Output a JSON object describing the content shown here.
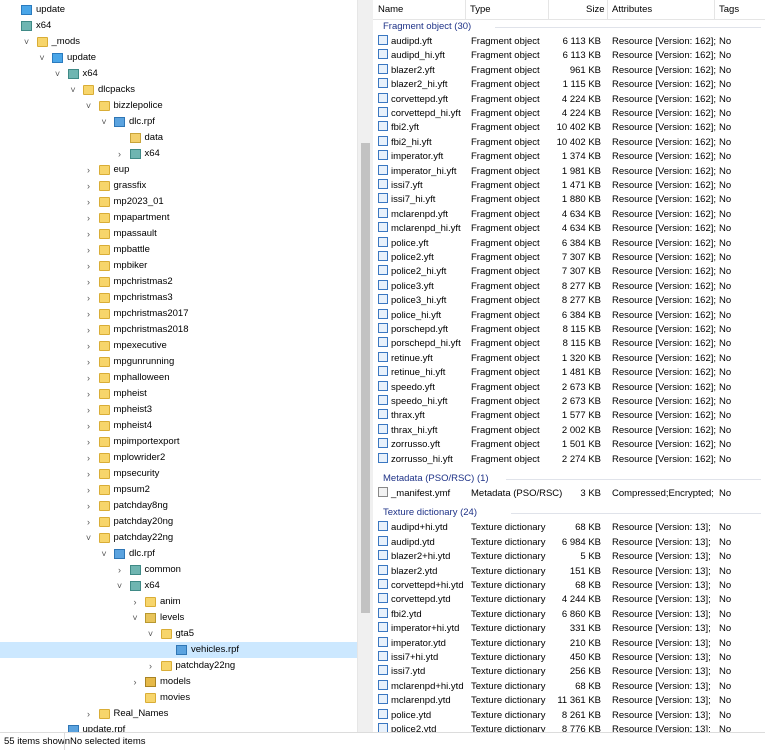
{
  "tree": [
    {
      "label": "update",
      "indent": 0,
      "chev": "",
      "icon": "folder-blue"
    },
    {
      "label": "x64",
      "indent": 0,
      "chev": "",
      "icon": "folder-teal"
    },
    {
      "label": "_mods",
      "indent": 1,
      "chev": "v",
      "icon": "folder"
    },
    {
      "label": "update",
      "indent": 2,
      "chev": "v",
      "icon": "folder-blue"
    },
    {
      "label": "x64",
      "indent": 3,
      "chev": "v",
      "icon": "folder-teal"
    },
    {
      "label": "dlcpacks",
      "indent": 4,
      "chev": "v",
      "icon": "folder"
    },
    {
      "label": "bizzlepolice",
      "indent": 5,
      "chev": "v",
      "icon": "folder"
    },
    {
      "label": "dlc.rpf",
      "indent": 6,
      "chev": "v",
      "icon": "rpf"
    },
    {
      "label": "data",
      "indent": 7,
      "chev": "",
      "icon": "data"
    },
    {
      "label": "x64",
      "indent": 7,
      "chev": ">",
      "icon": "folder-teal"
    },
    {
      "label": "eup",
      "indent": 5,
      "chev": ">",
      "icon": "folder"
    },
    {
      "label": "grassfix",
      "indent": 5,
      "chev": ">",
      "icon": "folder"
    },
    {
      "label": "mp2023_01",
      "indent": 5,
      "chev": ">",
      "icon": "folder"
    },
    {
      "label": "mpapartment",
      "indent": 5,
      "chev": ">",
      "icon": "folder"
    },
    {
      "label": "mpassault",
      "indent": 5,
      "chev": ">",
      "icon": "folder"
    },
    {
      "label": "mpbattle",
      "indent": 5,
      "chev": ">",
      "icon": "folder"
    },
    {
      "label": "mpbiker",
      "indent": 5,
      "chev": ">",
      "icon": "folder"
    },
    {
      "label": "mpchristmas2",
      "indent": 5,
      "chev": ">",
      "icon": "folder"
    },
    {
      "label": "mpchristmas3",
      "indent": 5,
      "chev": ">",
      "icon": "folder"
    },
    {
      "label": "mpchristmas2017",
      "indent": 5,
      "chev": ">",
      "icon": "folder"
    },
    {
      "label": "mpchristmas2018",
      "indent": 5,
      "chev": ">",
      "icon": "folder"
    },
    {
      "label": "mpexecutive",
      "indent": 5,
      "chev": ">",
      "icon": "folder"
    },
    {
      "label": "mpgunrunning",
      "indent": 5,
      "chev": ">",
      "icon": "folder"
    },
    {
      "label": "mphalloween",
      "indent": 5,
      "chev": ">",
      "icon": "folder"
    },
    {
      "label": "mpheist",
      "indent": 5,
      "chev": ">",
      "icon": "folder"
    },
    {
      "label": "mpheist3",
      "indent": 5,
      "chev": ">",
      "icon": "folder"
    },
    {
      "label": "mpheist4",
      "indent": 5,
      "chev": ">",
      "icon": "folder"
    },
    {
      "label": "mpimportexport",
      "indent": 5,
      "chev": ">",
      "icon": "folder"
    },
    {
      "label": "mplowrider2",
      "indent": 5,
      "chev": ">",
      "icon": "folder"
    },
    {
      "label": "mpsecurity",
      "indent": 5,
      "chev": ">",
      "icon": "folder"
    },
    {
      "label": "mpsum2",
      "indent": 5,
      "chev": ">",
      "icon": "folder"
    },
    {
      "label": "patchday8ng",
      "indent": 5,
      "chev": ">",
      "icon": "folder"
    },
    {
      "label": "patchday20ng",
      "indent": 5,
      "chev": ">",
      "icon": "folder"
    },
    {
      "label": "patchday22ng",
      "indent": 5,
      "chev": "v",
      "icon": "folder"
    },
    {
      "label": "dlc.rpf",
      "indent": 6,
      "chev": "v",
      "icon": "rpf"
    },
    {
      "label": "common",
      "indent": 7,
      "chev": ">",
      "icon": "folder-teal"
    },
    {
      "label": "x64",
      "indent": 7,
      "chev": "v",
      "icon": "folder-teal"
    },
    {
      "label": "anim",
      "indent": 8,
      "chev": ">",
      "icon": "folder"
    },
    {
      "label": "levels",
      "indent": 8,
      "chev": "v",
      "icon": "levels"
    },
    {
      "label": "gta5",
      "indent": 9,
      "chev": "v",
      "icon": "folder"
    },
    {
      "label": "vehicles.rpf",
      "indent": 10,
      "chev": "",
      "icon": "rpf",
      "selected": true
    },
    {
      "label": "patchday22ng",
      "indent": 9,
      "chev": ">",
      "icon": "folder"
    },
    {
      "label": "models",
      "indent": 8,
      "chev": ">",
      "icon": "models"
    },
    {
      "label": "movies",
      "indent": 8,
      "chev": "",
      "icon": "folder"
    },
    {
      "label": "Real_Names",
      "indent": 5,
      "chev": ">",
      "icon": "folder"
    },
    {
      "label": "update.rpf",
      "indent": 3,
      "chev": "",
      "icon": "rpf"
    }
  ],
  "columns": {
    "name": "Name",
    "type": "Type",
    "size": "Size",
    "attributes": "Attributes",
    "tags": "Tags"
  },
  "groups": [
    {
      "title": "Fragment object (30)",
      "icon": "file",
      "rows": [
        [
          "audipd.yft",
          "Fragment object",
          "6 113 KB",
          "Resource [Version: 162];",
          "No"
        ],
        [
          "audipd_hi.yft",
          "Fragment object",
          "6 113 KB",
          "Resource [Version: 162];",
          "No"
        ],
        [
          "blazer2.yft",
          "Fragment object",
          "961 KB",
          "Resource [Version: 162];",
          "No"
        ],
        [
          "blazer2_hi.yft",
          "Fragment object",
          "1 115 KB",
          "Resource [Version: 162];",
          "No"
        ],
        [
          "corvettepd.yft",
          "Fragment object",
          "4 224 KB",
          "Resource [Version: 162];",
          "No"
        ],
        [
          "corvettepd_hi.yft",
          "Fragment object",
          "4 224 KB",
          "Resource [Version: 162];",
          "No"
        ],
        [
          "fbi2.yft",
          "Fragment object",
          "10 402 KB",
          "Resource [Version: 162];",
          "No"
        ],
        [
          "fbi2_hi.yft",
          "Fragment object",
          "10 402 KB",
          "Resource [Version: 162];",
          "No"
        ],
        [
          "imperator.yft",
          "Fragment object",
          "1 374 KB",
          "Resource [Version: 162];",
          "No"
        ],
        [
          "imperator_hi.yft",
          "Fragment object",
          "1 981 KB",
          "Resource [Version: 162];",
          "No"
        ],
        [
          "issi7.yft",
          "Fragment object",
          "1 471 KB",
          "Resource [Version: 162];",
          "No"
        ],
        [
          "issi7_hi.yft",
          "Fragment object",
          "1 880 KB",
          "Resource [Version: 162];",
          "No"
        ],
        [
          "mclarenpd.yft",
          "Fragment object",
          "4 634 KB",
          "Resource [Version: 162];",
          "No"
        ],
        [
          "mclarenpd_hi.yft",
          "Fragment object",
          "4 634 KB",
          "Resource [Version: 162];",
          "No"
        ],
        [
          "police.yft",
          "Fragment object",
          "6 384 KB",
          "Resource [Version: 162];",
          "No"
        ],
        [
          "police2.yft",
          "Fragment object",
          "7 307 KB",
          "Resource [Version: 162];",
          "No"
        ],
        [
          "police2_hi.yft",
          "Fragment object",
          "7 307 KB",
          "Resource [Version: 162];",
          "No"
        ],
        [
          "police3.yft",
          "Fragment object",
          "8 277 KB",
          "Resource [Version: 162];",
          "No"
        ],
        [
          "police3_hi.yft",
          "Fragment object",
          "8 277 KB",
          "Resource [Version: 162];",
          "No"
        ],
        [
          "police_hi.yft",
          "Fragment object",
          "6 384 KB",
          "Resource [Version: 162];",
          "No"
        ],
        [
          "porschepd.yft",
          "Fragment object",
          "8 115 KB",
          "Resource [Version: 162];",
          "No"
        ],
        [
          "porschepd_hi.yft",
          "Fragment object",
          "8 115 KB",
          "Resource [Version: 162];",
          "No"
        ],
        [
          "retinue.yft",
          "Fragment object",
          "1 320 KB",
          "Resource [Version: 162];",
          "No"
        ],
        [
          "retinue_hi.yft",
          "Fragment object",
          "1 481 KB",
          "Resource [Version: 162];",
          "No"
        ],
        [
          "speedo.yft",
          "Fragment object",
          "2 673 KB",
          "Resource [Version: 162];",
          "No"
        ],
        [
          "speedo_hi.yft",
          "Fragment object",
          "2 673 KB",
          "Resource [Version: 162];",
          "No"
        ],
        [
          "thrax.yft",
          "Fragment object",
          "1 577 KB",
          "Resource [Version: 162];",
          "No"
        ],
        [
          "thrax_hi.yft",
          "Fragment object",
          "2 002 KB",
          "Resource [Version: 162];",
          "No"
        ],
        [
          "zorrusso.yft",
          "Fragment object",
          "1 501 KB",
          "Resource [Version: 162];",
          "No"
        ],
        [
          "zorrusso_hi.yft",
          "Fragment object",
          "2 274 KB",
          "Resource [Version: 162];",
          "No"
        ]
      ]
    },
    {
      "title": "Metadata (PSO/RSC) (1)",
      "icon": "meta",
      "rows": [
        [
          "_manifest.ymf",
          "Metadata (PSO/RSC)",
          "3 KB",
          "Compressed;Encrypted;",
          "No"
        ]
      ]
    },
    {
      "title": "Texture dictionary (24)",
      "icon": "file",
      "rows": [
        [
          "audipd+hi.ytd",
          "Texture dictionary",
          "68 KB",
          "Resource [Version: 13];",
          "No"
        ],
        [
          "audipd.ytd",
          "Texture dictionary",
          "6 984 KB",
          "Resource [Version: 13];",
          "No"
        ],
        [
          "blazer2+hi.ytd",
          "Texture dictionary",
          "5 KB",
          "Resource [Version: 13];",
          "No"
        ],
        [
          "blazer2.ytd",
          "Texture dictionary",
          "151 KB",
          "Resource [Version: 13];",
          "No"
        ],
        [
          "corvettepd+hi.ytd",
          "Texture dictionary",
          "68 KB",
          "Resource [Version: 13];",
          "No"
        ],
        [
          "corvettepd.ytd",
          "Texture dictionary",
          "4 244 KB",
          "Resource [Version: 13];",
          "No"
        ],
        [
          "fbi2.ytd",
          "Texture dictionary",
          "6 860 KB",
          "Resource [Version: 13];",
          "No"
        ],
        [
          "imperator+hi.ytd",
          "Texture dictionary",
          "331 KB",
          "Resource [Version: 13];",
          "No"
        ],
        [
          "imperator.ytd",
          "Texture dictionary",
          "210 KB",
          "Resource [Version: 13];",
          "No"
        ],
        [
          "issi7+hi.ytd",
          "Texture dictionary",
          "450 KB",
          "Resource [Version: 13];",
          "No"
        ],
        [
          "issi7.ytd",
          "Texture dictionary",
          "256 KB",
          "Resource [Version: 13];",
          "No"
        ],
        [
          "mclarenpd+hi.ytd",
          "Texture dictionary",
          "68 KB",
          "Resource [Version: 13];",
          "No"
        ],
        [
          "mclarenpd.ytd",
          "Texture dictionary",
          "11 361 KB",
          "Resource [Version: 13];",
          "No"
        ],
        [
          "police.ytd",
          "Texture dictionary",
          "8 261 KB",
          "Resource [Version: 13];",
          "No"
        ],
        [
          "police2.ytd",
          "Texture dictionary",
          "8 776 KB",
          "Resource [Version: 13];",
          "No"
        ]
      ]
    }
  ],
  "status": {
    "count": "55 items shown",
    "selection": "No selected items"
  }
}
